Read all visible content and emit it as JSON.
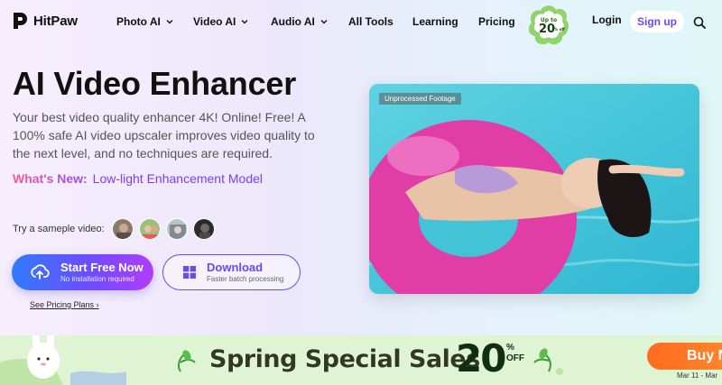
{
  "brand": {
    "name": "HitPaw"
  },
  "nav": {
    "items": [
      {
        "label": "Photo AI",
        "dropdown": true
      },
      {
        "label": "Video AI",
        "dropdown": true
      },
      {
        "label": "Audio AI",
        "dropdown": true
      },
      {
        "label": "All Tools",
        "dropdown": false
      },
      {
        "label": "Learning",
        "dropdown": false
      },
      {
        "label": "Pricing",
        "dropdown": false
      }
    ],
    "promo_badge": {
      "line1": "Up to",
      "value": "20",
      "unit": "% off"
    },
    "login": "Login",
    "signup": "Sign up",
    "search_icon": "search-icon"
  },
  "hero": {
    "title": "AI Video Enhancer",
    "description": "Your best video quality enhancer 4K! Online! Free! A 100% safe AI video upscaler improves video quality to the next level, and no techniques are required.",
    "whats_new_label": "What's New:",
    "whats_new_text": "Low-light Enhancement Model",
    "try_label": "Try a sameple video:",
    "primary_button": {
      "title": "Start Free Now",
      "subtitle": "No installation required",
      "icon": "upload-icon"
    },
    "secondary_button": {
      "title": "Download",
      "subtitle": "Faster batch processing",
      "icon": "windows-icon"
    },
    "pricing_link": "See Pricing Plans"
  },
  "media": {
    "tag": "Unprocessed Footage"
  },
  "banner": {
    "title": "Spring Special Sales",
    "percent": "20",
    "off_line1": "%",
    "off_line2": "OFF",
    "buy_label": "Buy N",
    "date": "Mar 11 - Mar"
  },
  "colors": {
    "accent": "#6a49f2",
    "primary_start": "#2f7bff",
    "primary_end": "#b13cff",
    "banner_bg": "#dff4d2",
    "buy": "#ff6a1f"
  }
}
